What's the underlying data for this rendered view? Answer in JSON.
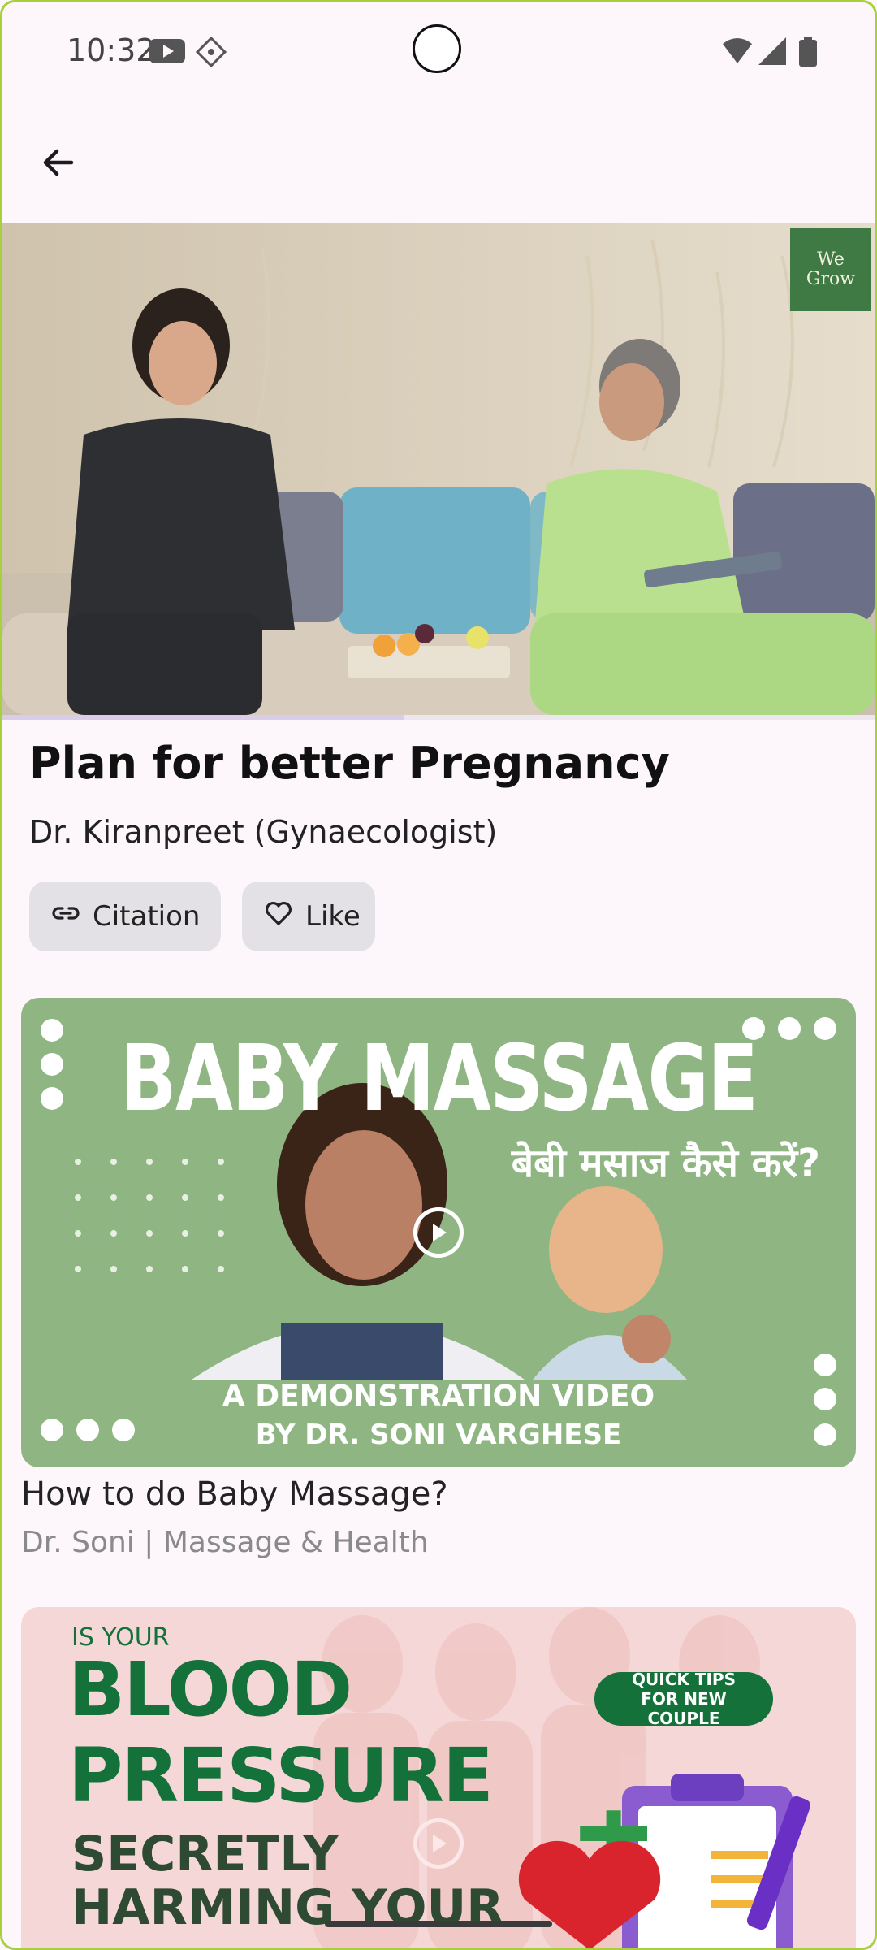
{
  "status_bar": {
    "time": "10:32"
  },
  "app_bar": {
    "back_icon": "arrow-left-icon"
  },
  "hero": {
    "logo_text": "We Grow",
    "progress_fraction": 0.46
  },
  "video": {
    "title": "Plan for better Pregnancy",
    "author": "Dr. Kiranpreet (Gynaecologist)",
    "actions": [
      {
        "label": "Citation",
        "icon": "link-icon"
      },
      {
        "label": "Like",
        "icon": "heart-icon"
      }
    ]
  },
  "related": [
    {
      "thumb_heading": "BABY MASSAGE",
      "thumb_subheading": "बेबी मसाज कैसे करें?",
      "thumb_caption_1": "A DEMONSTRATION VIDEO",
      "thumb_caption_2": "BY DR. SONI VARGHESE",
      "title": "How to do Baby Massage?",
      "subtitle": "Dr. Soni | Massage & Health"
    },
    {
      "thumb_kicker": "IS YOUR",
      "thumb_line_1": "BLOOD",
      "thumb_line_2": "PRESSURE",
      "thumb_line_3": "SECRETLY",
      "thumb_line_4": "HARMING YOUR",
      "thumb_badge": "QUICK TIPS FOR NEW COUPLE"
    }
  ],
  "colors": {
    "background": "#fdf7fc",
    "chip": "#e3e1e6",
    "card1_bg": "#8fb682",
    "card2_text": "#14713a",
    "logo_bg": "#3f7a45"
  }
}
